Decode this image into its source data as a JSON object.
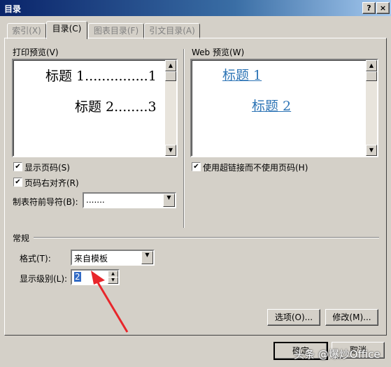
{
  "window": {
    "title": "目录",
    "help_button": "?",
    "close_button": "×"
  },
  "tabs": [
    {
      "label": "索引(X)",
      "active": false
    },
    {
      "label": "目录(C)",
      "active": true
    },
    {
      "label": "图表目录(F)",
      "active": false
    },
    {
      "label": "引文目录(A)",
      "active": false
    }
  ],
  "print_preview": {
    "label": "打印预览(V)",
    "line1": "标题 1...............1",
    "line2": "标题 2........3"
  },
  "web_preview": {
    "label": "Web 预览(W)",
    "link1": "标题 1",
    "link2": "标题 2"
  },
  "options_left": {
    "show_page_numbers": "显示页码(S)",
    "right_align_page_numbers": "页码右对齐(R)",
    "tab_leader_label": "制表符前导符(B):",
    "tab_leader_value": "......."
  },
  "options_right": {
    "use_hyperlinks": "使用超链接而不使用页码(H)"
  },
  "general": {
    "section_label": "常规",
    "format_label": "格式(T):",
    "format_value": "来自模板",
    "levels_label": "显示级别(L):",
    "levels_value": "2"
  },
  "buttons": {
    "options": "选项(O)...",
    "modify": "修改(M)...",
    "ok": "确定",
    "cancel": "取消"
  },
  "watermark": "头条 @爆炒Office",
  "colors": {
    "accent_link": "#2e75b6",
    "annotation_arrow": "#e8262b"
  }
}
